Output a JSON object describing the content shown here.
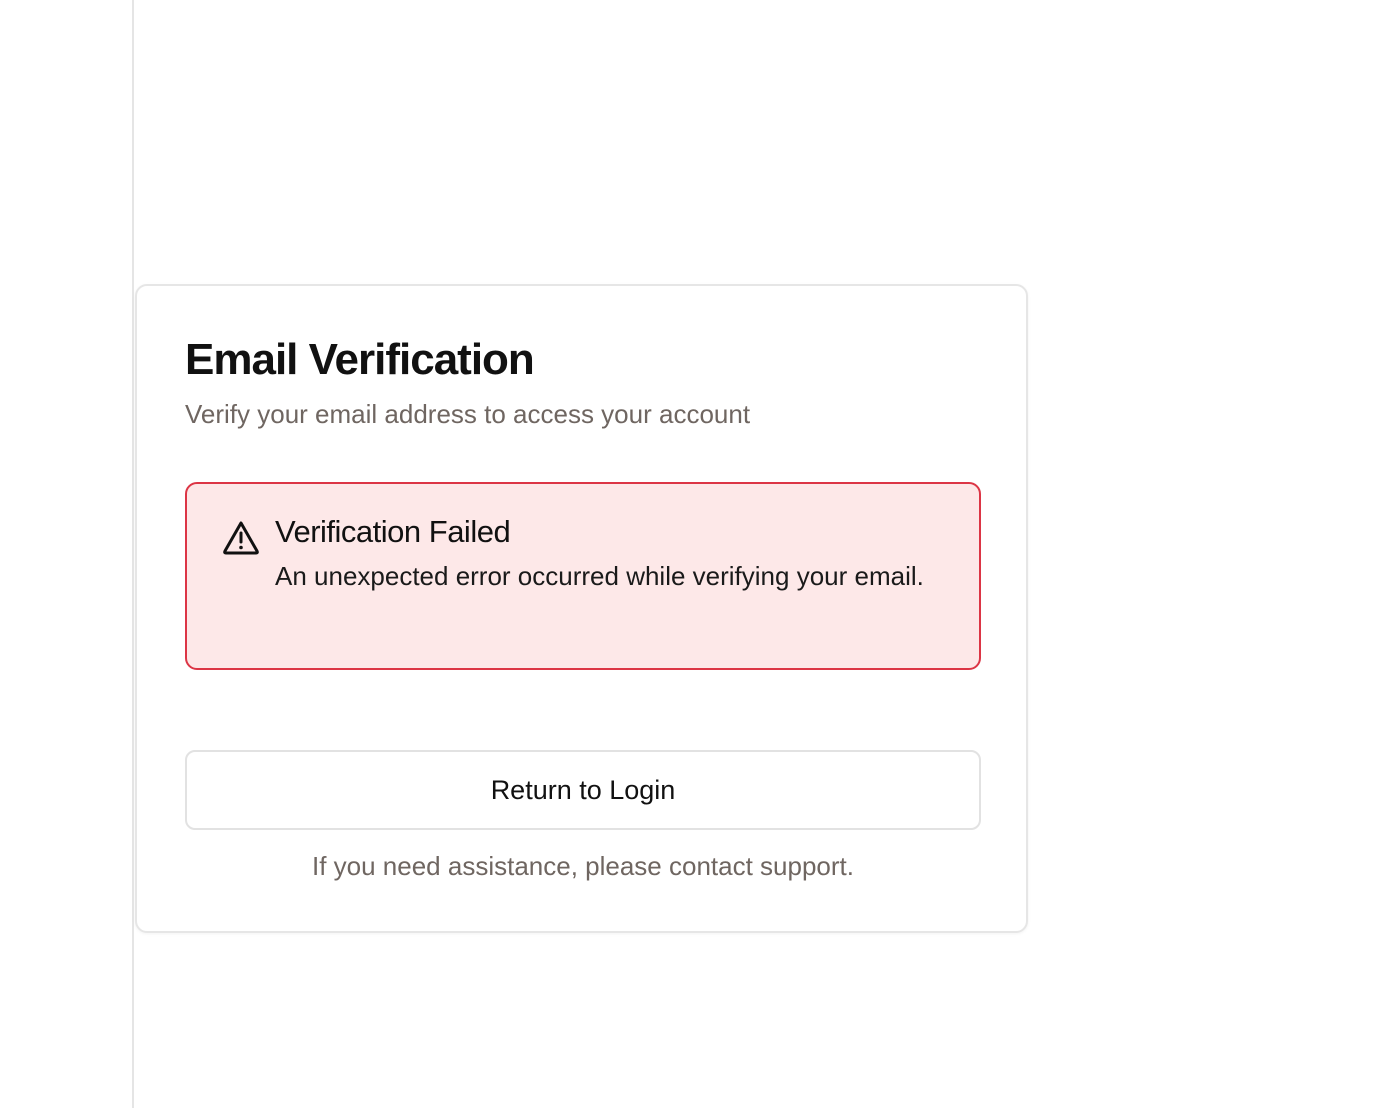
{
  "card": {
    "title": "Email Verification",
    "subtitle": "Verify your email address to access your account"
  },
  "alert": {
    "icon": "warning-triangle-icon",
    "title": "Verification Failed",
    "message": "An unexpected error occurred while verifying your email.",
    "background_color": "#fde8e8",
    "border_color": "#dc3545"
  },
  "actions": {
    "return_label": "Return to Login"
  },
  "footer": {
    "support_text": "If you need assistance, please contact support."
  }
}
